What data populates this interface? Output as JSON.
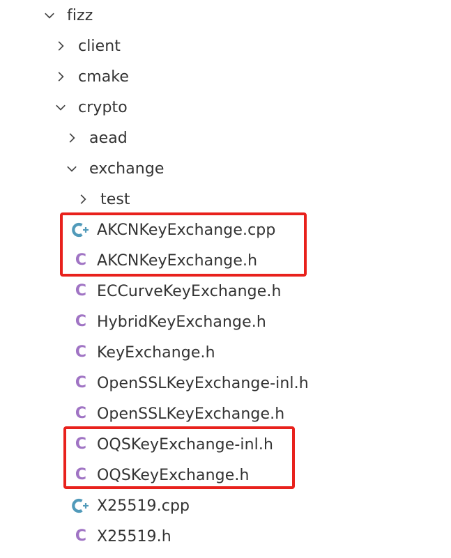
{
  "tree": {
    "root": {
      "label": "fizz",
      "expanded": true
    },
    "folders": {
      "client": {
        "label": "client",
        "expanded": false
      },
      "cmake": {
        "label": "cmake",
        "expanded": false
      },
      "crypto": {
        "label": "crypto",
        "expanded": true
      },
      "aead": {
        "label": "aead",
        "expanded": false
      },
      "exchange": {
        "label": "exchange",
        "expanded": true
      },
      "test": {
        "label": "test",
        "expanded": false
      }
    },
    "files": [
      {
        "label": "AKCNKeyExchange.cpp",
        "icon": "cpp-icon"
      },
      {
        "label": "AKCNKeyExchange.h",
        "icon": "c-header-icon"
      },
      {
        "label": "ECCurveKeyExchange.h",
        "icon": "c-header-icon"
      },
      {
        "label": "HybridKeyExchange.h",
        "icon": "c-header-icon"
      },
      {
        "label": "KeyExchange.h",
        "icon": "c-header-icon"
      },
      {
        "label": "OpenSSLKeyExchange-inl.h",
        "icon": "c-header-icon"
      },
      {
        "label": "OpenSSLKeyExchange.h",
        "icon": "c-header-icon"
      },
      {
        "label": "OQSKeyExchange-inl.h",
        "icon": "c-header-icon"
      },
      {
        "label": "OQSKeyExchange.h",
        "icon": "c-header-icon"
      },
      {
        "label": "X25519.cpp",
        "icon": "cpp-icon"
      },
      {
        "label": "X25519.h",
        "icon": "c-header-icon"
      }
    ]
  },
  "colors": {
    "highlight_border": "#e8211c",
    "cpp_icon": "#519aba",
    "c_header_icon": "#a074c4",
    "text": "#333333"
  },
  "icons": {
    "c_header_glyph": "C",
    "expanded": "chevron-down-icon",
    "collapsed": "chevron-right-icon"
  }
}
